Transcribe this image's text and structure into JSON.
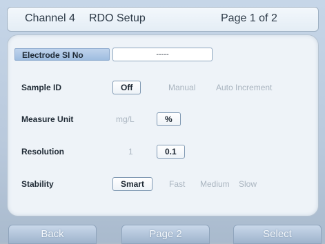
{
  "header": {
    "channel": "Channel 4",
    "title": "RDO Setup",
    "page": "Page 1 of 2"
  },
  "rows": {
    "electrode": {
      "label": "Electrode SI No",
      "value": "-----"
    },
    "sample_id": {
      "label": "Sample ID",
      "selected": "Off",
      "options": [
        "Manual",
        "Auto Increment"
      ]
    },
    "measure_unit": {
      "label": "Measure Unit",
      "options_before": [
        "mg/L"
      ],
      "selected": "%"
    },
    "resolution": {
      "label": "Resolution",
      "options_before": [
        "1"
      ],
      "selected": "0.1"
    },
    "stability": {
      "label": "Stability",
      "selected": "Smart",
      "options": [
        "Fast",
        "Medium",
        "Slow"
      ]
    }
  },
  "footer": {
    "back": "Back",
    "page2": "Page 2",
    "select": "Select"
  },
  "colors": {
    "selected_label_bg": "#9fbde0",
    "background": "#b9c9dc"
  }
}
